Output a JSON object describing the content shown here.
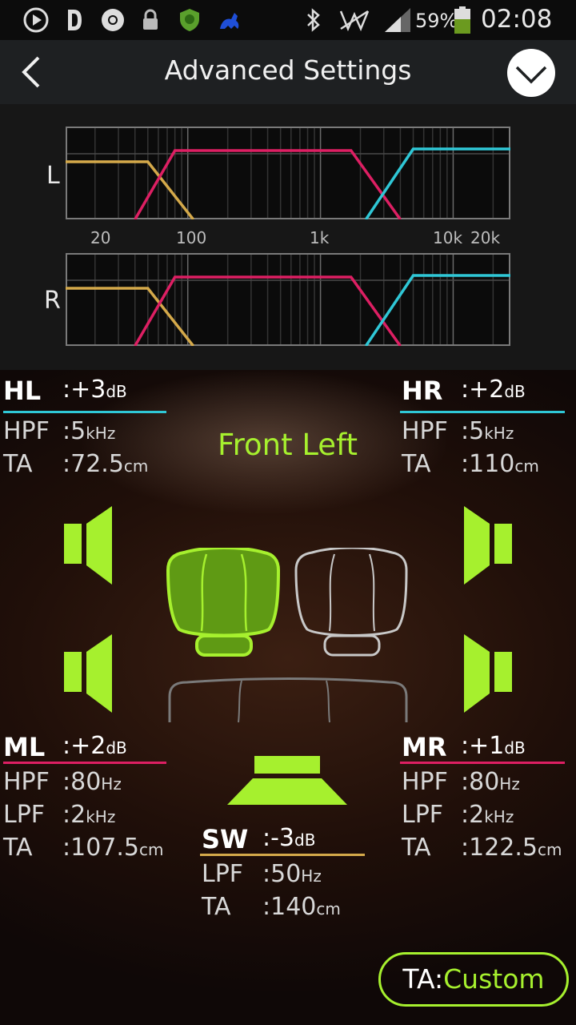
{
  "status_bar": {
    "battery": "59%",
    "time": "02:08",
    "left_icons": [
      "play-circle-icon",
      "d-icon",
      "chrome-icon",
      "lock-icon",
      "shield-icon",
      "dragon-icon"
    ],
    "right_icons": [
      "bluetooth-icon",
      "no-signal-icon",
      "signal-icon",
      "battery-icon"
    ]
  },
  "header": {
    "title": "Advanced Settings",
    "back_icon": "chevron-left-icon",
    "confirm_icon": "chevron-down-icon"
  },
  "graph": {
    "left_label": "L",
    "right_label": "R",
    "freq_ticks": [
      "20",
      "100",
      "1k",
      "10k",
      "20k"
    ],
    "colors": {
      "sw": "#d4a94a",
      "mid": "#dd1f63",
      "high": "#2fc7d6"
    }
  },
  "position_label": "Front Left",
  "channels": {
    "hl": {
      "name": "HL",
      "gain": ":+3",
      "gain_unit": "dB",
      "hpf_label": "HPF",
      "hpf_value": ":5",
      "hpf_unit": "kHz",
      "ta_label": "TA",
      "ta_value": ":72.5",
      "ta_unit": "cm"
    },
    "hr": {
      "name": "HR",
      "gain": ":+2",
      "gain_unit": "dB",
      "hpf_label": "HPF",
      "hpf_value": ":5",
      "hpf_unit": "kHz",
      "ta_label": "TA",
      "ta_value": ":110",
      "ta_unit": "cm"
    },
    "ml": {
      "name": "ML",
      "gain": ":+2",
      "gain_unit": "dB",
      "hpf_label": "HPF",
      "hpf_value": ":80",
      "hpf_unit": "Hz",
      "lpf_label": "LPF",
      "lpf_value": ":2",
      "lpf_unit": "kHz",
      "ta_label": "TA",
      "ta_value": ":107.5",
      "ta_unit": "cm"
    },
    "mr": {
      "name": "MR",
      "gain": ":+1",
      "gain_unit": "dB",
      "hpf_label": "HPF",
      "hpf_value": ":80",
      "hpf_unit": "Hz",
      "lpf_label": "LPF",
      "lpf_value": ":2",
      "lpf_unit": "kHz",
      "ta_label": "TA",
      "ta_value": ":122.5",
      "ta_unit": "cm"
    },
    "sw": {
      "name": "SW",
      "gain": ":-3",
      "gain_unit": "dB",
      "lpf_label": "LPF",
      "lpf_value": ":50",
      "lpf_unit": "Hz",
      "ta_label": "TA",
      "ta_value": ":140",
      "ta_unit": "cm"
    }
  },
  "ta_button": {
    "prefix": "TA:",
    "value": "Custom"
  },
  "accent_color": "#a6f02e"
}
